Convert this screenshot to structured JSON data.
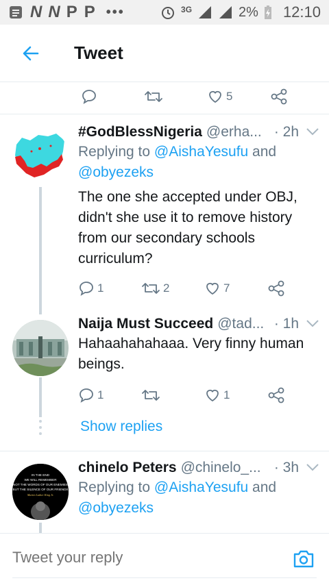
{
  "status_bar": {
    "notification_icons": [
      "N",
      "N",
      "P",
      "P"
    ],
    "network": "3G",
    "battery": "2%",
    "time": "12:10"
  },
  "header": {
    "title": "Tweet"
  },
  "top_actions": {
    "like_count": "5"
  },
  "tweets": [
    {
      "name": "#GodBlessNigeria",
      "handle": "@erha...",
      "time": "· 2h",
      "reply_prefix": "Replying to ",
      "mention_1": "@AishaYesufu",
      "reply_and": " and",
      "mention_2": "@obyezeks",
      "text": "The one she accepted under OBJ, didn't she use it to remove history from our secondary schools curriculum?",
      "reply_count": "1",
      "retweet_count": "2",
      "like_count": "7"
    },
    {
      "name": "Naija Must Succeed",
      "handle": "@tad...",
      "time": "· 1h",
      "text": "Hahaahahahaaa.  Very finny human beings.",
      "reply_count": "1",
      "retweet_count": "",
      "like_count": "1"
    },
    {
      "name": "chinelo Peters",
      "handle": "@chinelo_...",
      "time": "· 3h",
      "reply_prefix": "Replying to ",
      "mention_1": "@AishaYesufu",
      "reply_and": " and",
      "mention_2": "@obyezeks",
      "avatar_quote": [
        "IN THE END",
        "WE WILL REMEMBER",
        "NOT THE WORDS OF OUR ENEMIES",
        "BUT THE SILENCE OF OUR FRIENDS",
        "Martin Luther King Jr."
      ]
    }
  ],
  "show_replies": "Show replies",
  "reply_bar": {
    "placeholder": "Tweet your reply"
  },
  "colors": {
    "accent": "#1da1f2",
    "muted": "#657786",
    "text": "#14171a",
    "divider": "#e6ecf0"
  }
}
